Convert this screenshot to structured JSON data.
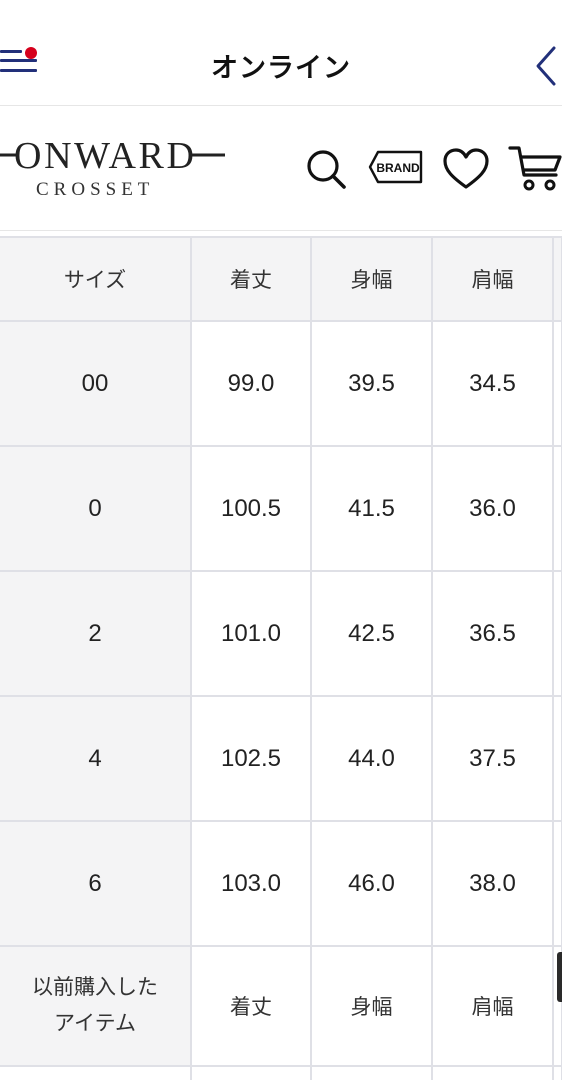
{
  "header": {
    "title": "オンライン",
    "colors": {
      "navy": "#22307a",
      "red": "#d6001c"
    }
  },
  "brand": {
    "logo_text": "ONWARD",
    "logo_subtext": "CROSSET",
    "brand_icon_label": "BRAND",
    "icons": [
      "search-icon",
      "brand-tag-icon",
      "heart-icon",
      "cart-icon"
    ]
  },
  "table": {
    "headers": [
      "サイズ",
      "着丈",
      "身幅",
      "肩幅"
    ],
    "rows": [
      {
        "size": "00",
        "cols": [
          "99.0",
          "39.5",
          "34.5"
        ]
      },
      {
        "size": "0",
        "cols": [
          "100.5",
          "41.5",
          "36.0"
        ]
      },
      {
        "size": "2",
        "cols": [
          "101.0",
          "42.5",
          "36.5"
        ]
      },
      {
        "size": "4",
        "cols": [
          "102.5",
          "44.0",
          "37.5"
        ]
      },
      {
        "size": "6",
        "cols": [
          "103.0",
          "46.0",
          "38.0"
        ]
      }
    ],
    "previous_header": {
      "label_line1": "以前購入した",
      "label_line2": "アイテム",
      "cols": [
        "着丈",
        "身幅",
        "肩幅"
      ]
    }
  }
}
